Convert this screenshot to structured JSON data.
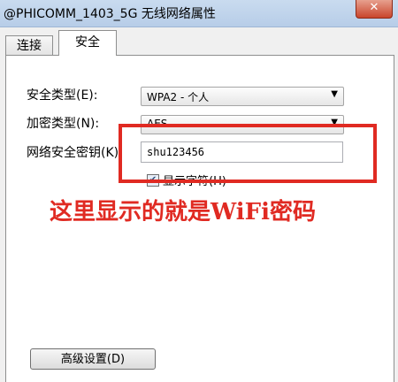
{
  "window": {
    "title": "@PHICOMM_1403_5G 无线网络属性",
    "close_glyph": "✕"
  },
  "tabs": [
    {
      "label": "连接",
      "active": false
    },
    {
      "label": "安全",
      "active": true
    }
  ],
  "form": {
    "security_type": {
      "label": "安全类型(E):",
      "value": "WPA2 - 个人"
    },
    "encryption_type": {
      "label": "加密类型(N):",
      "value": "AES"
    },
    "network_key": {
      "label": "网络安全密钥(K)",
      "value": "shu123456"
    },
    "show_chars": {
      "label": "显示字符(H)",
      "checked": true
    }
  },
  "annotation": {
    "text": "这里显示的就是WiFi密码",
    "color": "#e02a22"
  },
  "advanced_button": {
    "label": "高级设置(D)"
  },
  "icons": {
    "dropdown": "chevron-down-icon",
    "close": "close-icon",
    "check": "checkmark-icon"
  }
}
